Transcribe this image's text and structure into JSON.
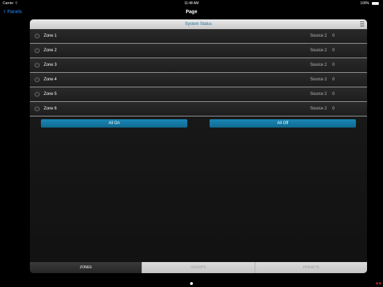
{
  "status_bar": {
    "carrier": "Carrier",
    "time": "11:48 AM",
    "battery": "100%"
  },
  "nav": {
    "back_label": "Panels",
    "title": "Page"
  },
  "panel": {
    "header": "System Status",
    "zones": [
      {
        "name": "Zone 1",
        "source": "Source 2",
        "level": "0"
      },
      {
        "name": "Zone 2",
        "source": "Source 2",
        "level": "0"
      },
      {
        "name": "Zone 3",
        "source": "Source 2",
        "level": "0"
      },
      {
        "name": "Zone 4",
        "source": "Source 2",
        "level": "0"
      },
      {
        "name": "Zone 5",
        "source": "Source 2",
        "level": "0"
      },
      {
        "name": "Zone 6",
        "source": "Source 2",
        "level": "0"
      }
    ],
    "all_on_label": "All On",
    "all_off_label": "All Off"
  },
  "tabs": [
    {
      "label": "ZONES",
      "active": true
    },
    {
      "label": "GROUPS",
      "active": false
    },
    {
      "label": "PRESETS",
      "active": false
    }
  ],
  "colors": {
    "accent": "#1e88ff",
    "button": "#12779f",
    "header_text": "#1c6f9c"
  }
}
